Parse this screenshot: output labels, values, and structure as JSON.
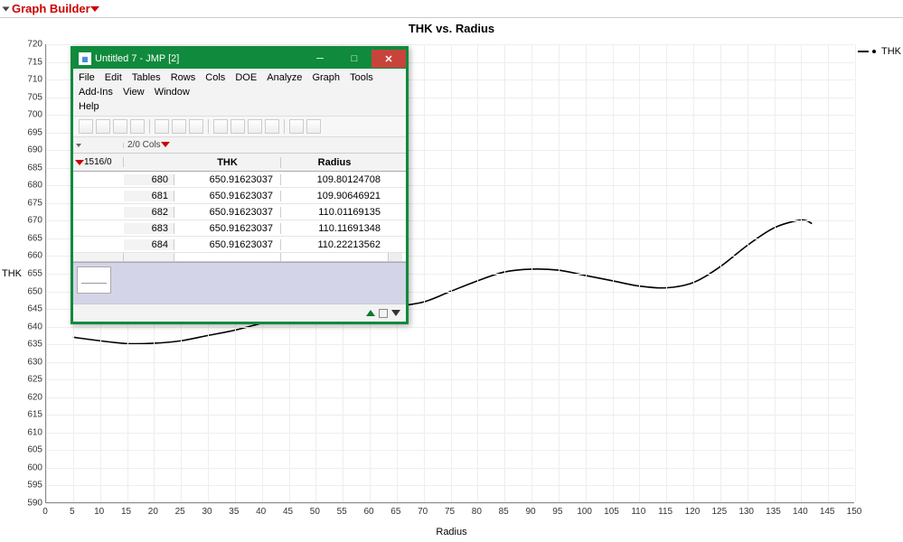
{
  "panel": {
    "title": "Graph Builder"
  },
  "chart_data": {
    "type": "line",
    "title": "THK vs. Radius",
    "xlabel": "Radius",
    "ylabel": "THK",
    "xlim": [
      0,
      150
    ],
    "ylim": [
      590,
      720
    ],
    "xticks": [
      0,
      5,
      10,
      15,
      20,
      25,
      30,
      35,
      40,
      45,
      50,
      55,
      60,
      65,
      70,
      75,
      80,
      85,
      90,
      95,
      100,
      105,
      110,
      115,
      120,
      125,
      130,
      135,
      140,
      145,
      150
    ],
    "yticks": [
      590,
      595,
      600,
      605,
      610,
      615,
      620,
      625,
      630,
      635,
      640,
      645,
      650,
      655,
      660,
      665,
      670,
      675,
      680,
      685,
      690,
      695,
      700,
      705,
      710,
      715,
      720
    ],
    "series": [
      {
        "name": "THK",
        "x": [
          5,
          10,
          15,
          20,
          25,
          30,
          35,
          40,
          45,
          50,
          55,
          60,
          65,
          70,
          75,
          80,
          85,
          90,
          95,
          100,
          105,
          110,
          115,
          120,
          125,
          130,
          135,
          140,
          142
        ],
        "y": [
          637,
          636,
          635.2,
          635.3,
          636,
          637.5,
          639,
          641,
          643,
          644,
          644.7,
          645.2,
          645.8,
          647,
          650,
          653,
          655.5,
          656.3,
          656,
          654.5,
          653,
          651.5,
          651,
          652.5,
          657,
          663,
          668,
          670.2,
          669.2
        ]
      }
    ],
    "legend": [
      "THK"
    ]
  },
  "window": {
    "title": "Untitled 7 - JMP [2]",
    "menu": [
      "File",
      "Edit",
      "Tables",
      "Rows",
      "Cols",
      "DOE",
      "Analyze",
      "Graph",
      "Tools",
      "Add-Ins",
      "View",
      "Window",
      "Help"
    ],
    "cols_summary": "2/0 Cols",
    "rows_summary": "1516/0",
    "columns": [
      "THK",
      "Radius"
    ],
    "rows": [
      {
        "n": 680,
        "thk": "650.91623037",
        "radius": "109.80124708"
      },
      {
        "n": 681,
        "thk": "650.91623037",
        "radius": "109.90646921"
      },
      {
        "n": 682,
        "thk": "650.91623037",
        "radius": "110.01169135"
      },
      {
        "n": 683,
        "thk": "650.91623037",
        "radius": "110.11691348"
      },
      {
        "n": 684,
        "thk": "650.91623037",
        "radius": "110.22213562"
      }
    ]
  }
}
